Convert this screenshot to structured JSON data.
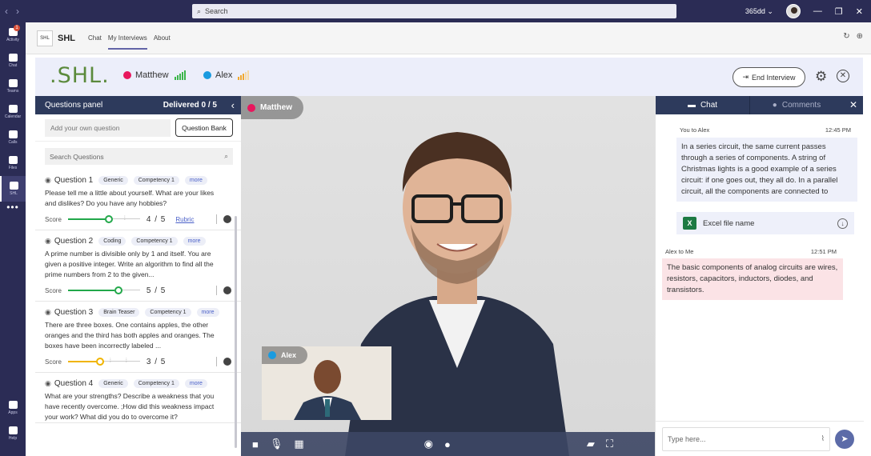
{
  "titlebar": {
    "search_placeholder": "Search",
    "account": "365dd ⌄"
  },
  "rail": {
    "activity_badge": "1",
    "items": [
      {
        "label": "Activity"
      },
      {
        "label": "Chat"
      },
      {
        "label": "Teams"
      },
      {
        "label": "Calendar"
      },
      {
        "label": "Calls"
      },
      {
        "label": "Files"
      },
      {
        "label": "SHL"
      }
    ],
    "more": "•••",
    "bottom_items": [
      {
        "label": "Apps"
      },
      {
        "label": "Help"
      }
    ]
  },
  "apphead": {
    "logo": "SHL",
    "name": "SHL",
    "tabs": [
      "Chat",
      "My Interviews",
      "About"
    ]
  },
  "header": {
    "logo": ".SHL.",
    "participants": [
      {
        "name": "Matthew",
        "color": "#e8175d",
        "signal": "#3bb54a"
      },
      {
        "name": "Alex",
        "color": "#1a9be0",
        "signal": "#f0a830"
      }
    ],
    "end_interview": "End Interview"
  },
  "questions": {
    "title": "Questions panel",
    "delivered": "Delivered 0 / 5",
    "add_placeholder": "Add your own question",
    "bank_button": "Question Bank",
    "search_placeholder": "Search Questions",
    "score_label": "Score",
    "rubric": "Rubric",
    "items": [
      {
        "title": "Question 1",
        "tags": [
          "Generic",
          "Competency 1",
          "more"
        ],
        "text": "Please tell me a little about yourself. What are your likes and dislikes? Do you have any hobbies?",
        "score_text": "4 / 5",
        "score_fraction": 0.8,
        "color": "#22a84a",
        "rubric": true
      },
      {
        "title": "Question 2",
        "tags": [
          "Coding",
          "Competency 1",
          "more"
        ],
        "text": "A prime number is divisible only by 1 and itself. You are given a positive integer. Write an algorithm to find all the prime numbers from 2 to the given...",
        "score_text": "5 / 5",
        "score_fraction": 1.0,
        "color": "#22a84a",
        "rubric": false
      },
      {
        "title": "Question 3",
        "tags": [
          "Brain Teaser",
          "Competency 1",
          "more"
        ],
        "text": "There are three boxes. One contains apples, the other oranges and the third has both apples and oranges. The boxes have been incorrectly labeled ...",
        "score_text": "3 / 5",
        "score_fraction": 0.6,
        "color": "#f0b400",
        "rubric": false
      },
      {
        "title": "Question 4",
        "tags": [
          "Generic",
          "Competency 1",
          "more"
        ],
        "text": "What are your strengths? Describe a weakness that you have recently overcome. ;How did this weakness impact your work? What did you do to overcome it?",
        "score_text": "",
        "score_fraction": null,
        "color": "#22a84a",
        "rubric": false
      }
    ]
  },
  "video": {
    "main_name": "Matthew",
    "main_color": "#e8175d",
    "pip_name": "Alex",
    "pip_color": "#1a9be0"
  },
  "chat": {
    "tab_chat": "Chat",
    "tab_comments": "Comments",
    "messages": [
      {
        "from": "You to Alex",
        "time": "12:45 PM",
        "text": "In a series circuit, the same current passes through a series of components. A string of Christmas lights is a good example of a series circuit: if one goes out, they all do. In a parallel circuit, all the components are connected to"
      },
      {
        "from": "Alex to Me",
        "time": "12:51 PM",
        "text": "The basic components of analog circuits are wires, resistors, capacitors, inductors, diodes, and transistors."
      }
    ],
    "file_name": "Excel file name",
    "input_placeholder": "Type here..."
  }
}
